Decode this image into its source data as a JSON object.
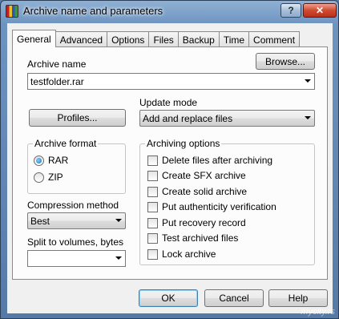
{
  "window": {
    "title": "Archive name and parameters",
    "help_label": "?",
    "close_label": "✕"
  },
  "tabs": [
    "General",
    "Advanced",
    "Options",
    "Files",
    "Backup",
    "Time",
    "Comment"
  ],
  "general": {
    "archive_name_label": "Archive name",
    "browse_label": "Browse...",
    "archive_name_value": "testfolder.rar",
    "update_mode_label": "Update mode",
    "profiles_label": "Profiles...",
    "update_mode_value": "Add and replace files",
    "archive_format": {
      "title": "Archive format",
      "options": [
        {
          "label": "RAR",
          "checked": true
        },
        {
          "label": "ZIP",
          "checked": false
        }
      ]
    },
    "compression_label": "Compression method",
    "compression_value": "Best",
    "split_label": "Split to volumes, bytes",
    "split_value": "",
    "archiving_options": {
      "title": "Archiving options",
      "items": [
        {
          "label": "Delete files after archiving",
          "checked": false
        },
        {
          "label": "Create SFX archive",
          "checked": false
        },
        {
          "label": "Create solid archive",
          "checked": false
        },
        {
          "label": "Put authenticity verification",
          "checked": false
        },
        {
          "label": "Put recovery record",
          "checked": false
        },
        {
          "label": "Test archived files",
          "checked": false
        },
        {
          "label": "Lock archive",
          "checked": false
        }
      ]
    }
  },
  "buttons": {
    "ok": "OK",
    "cancel": "Cancel",
    "help": "Help"
  },
  "watermark": "mycity.rs"
}
